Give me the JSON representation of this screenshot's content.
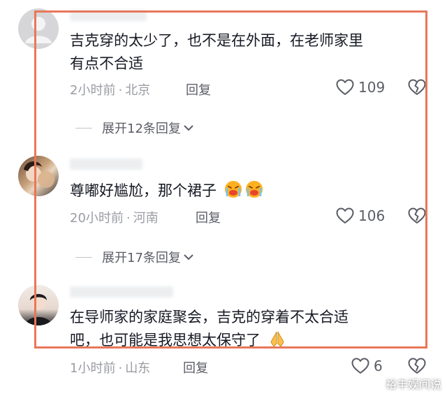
{
  "comments": [
    {
      "lines": [
        "吉克穿的太少了，也不是在外面，在老师家里",
        "有点不合适"
      ],
      "time": "2小时前",
      "location": "北京",
      "reply_label": "回复",
      "likes": "109",
      "expand_label": "展开12条回复",
      "avatar_icon": "default-avatar-icon"
    },
    {
      "lines": [
        "尊嘟好尴尬，那个裙子"
      ],
      "time": "20小时前",
      "location": "河南",
      "reply_label": "回复",
      "likes": "106",
      "expand_label": "展开17条回复",
      "emojis": [
        "crying-face-emoji",
        "crying-face-emoji"
      ]
    },
    {
      "lines": [
        "在导师家的家庭聚会，吉克的穿着不太合适",
        "吧，也可能是我思想太保守了"
      ],
      "time": "1小时前",
      "location": "山东",
      "reply_label": "回复",
      "likes": "6",
      "emojis": [
        "praying-hands-emoji"
      ]
    }
  ],
  "separator": "·",
  "watermark": "裕丰娱间说",
  "colors": {
    "highlight_frame": "#e8775a",
    "meta_text": "#9a9ca3",
    "body_text": "#161823"
  }
}
